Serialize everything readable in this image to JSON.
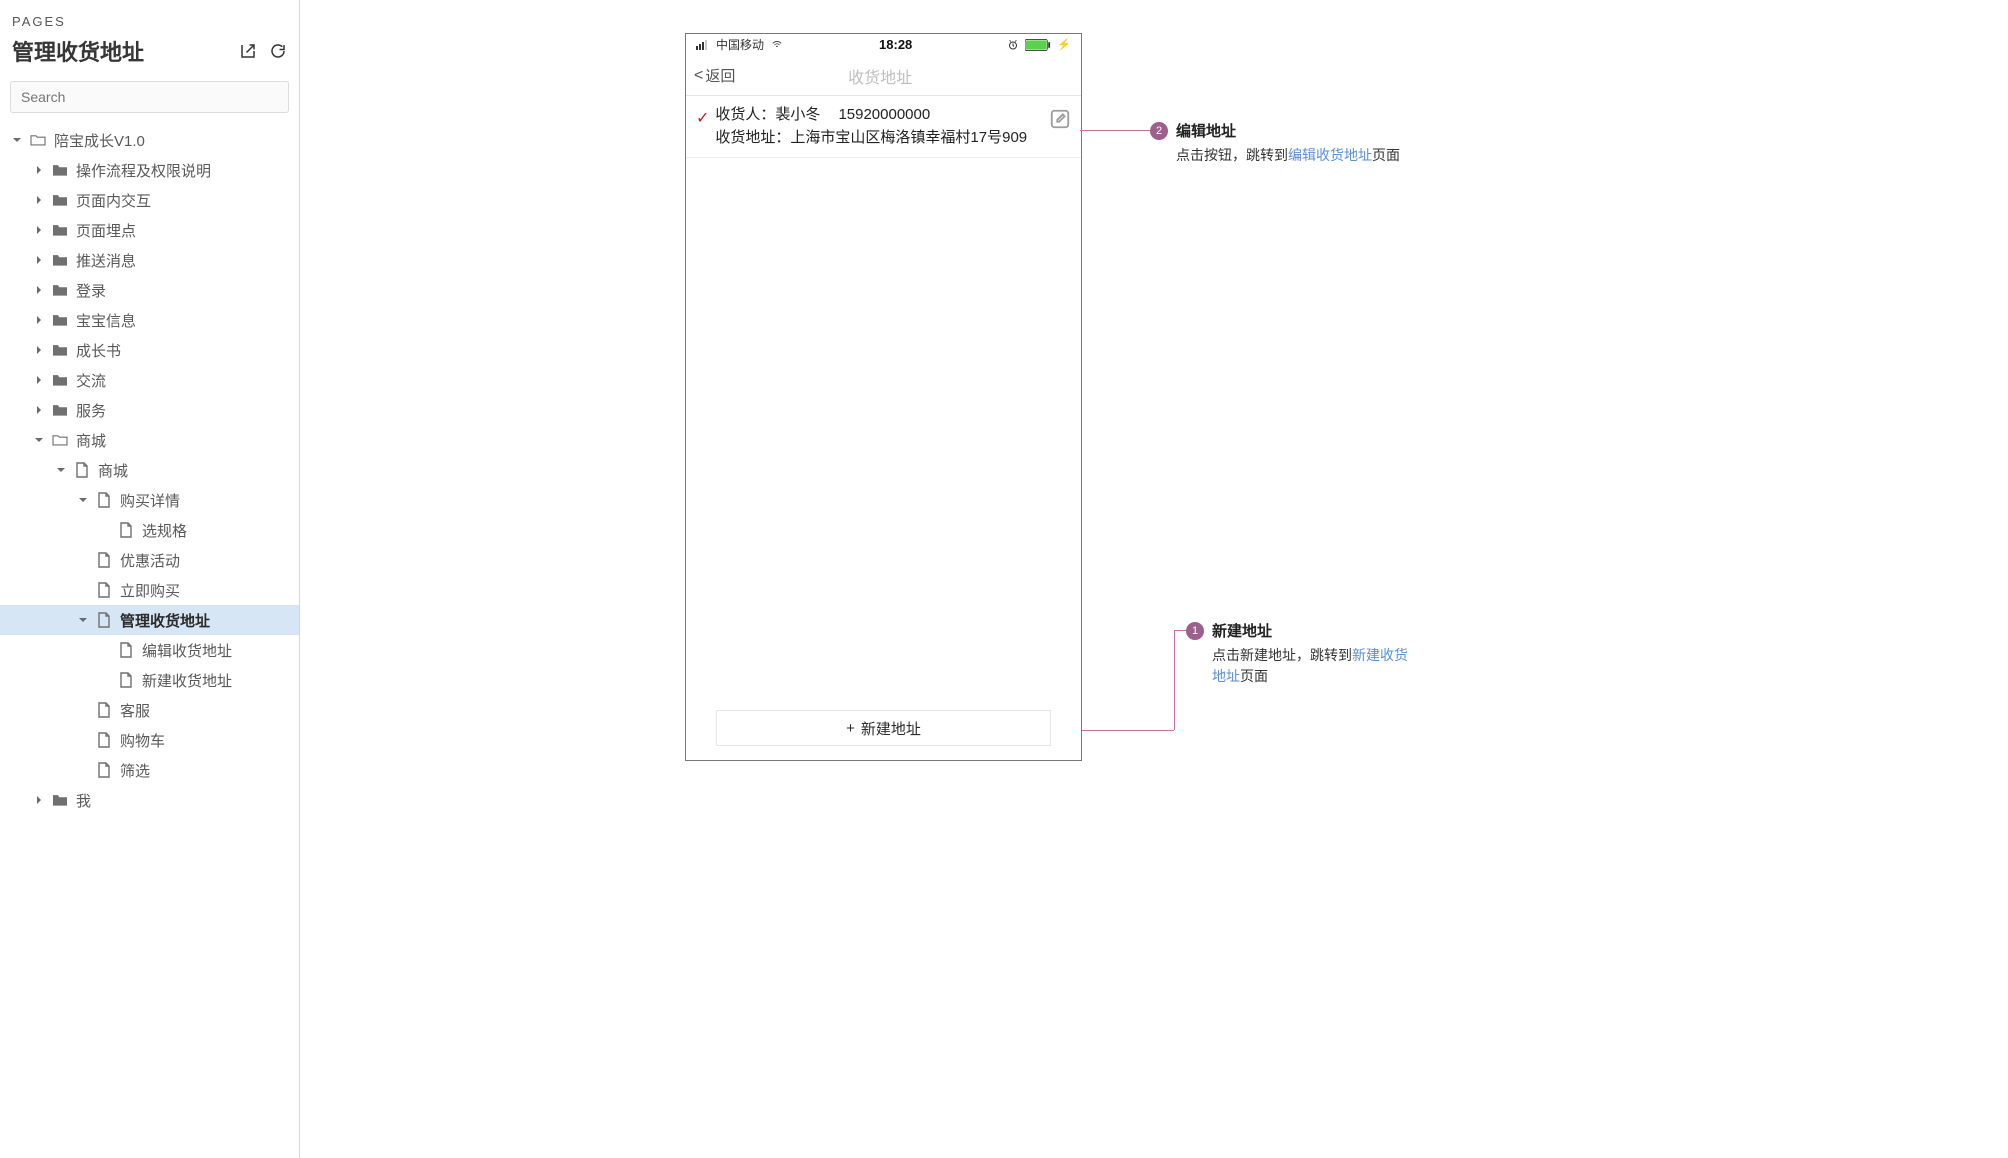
{
  "sidebar": {
    "pages_label": "PAGES",
    "page_title": "管理收货地址",
    "search_placeholder": "Search",
    "tree": [
      {
        "label": "陪宝成长V1.0",
        "icon": "folder-open",
        "indent": 0,
        "arrow": "down"
      },
      {
        "label": "操作流程及权限说明",
        "icon": "folder",
        "indent": 1,
        "arrow": "right"
      },
      {
        "label": "页面内交互",
        "icon": "folder",
        "indent": 1,
        "arrow": "right"
      },
      {
        "label": "页面埋点",
        "icon": "folder",
        "indent": 1,
        "arrow": "right"
      },
      {
        "label": "推送消息",
        "icon": "folder",
        "indent": 1,
        "arrow": "right"
      },
      {
        "label": "登录",
        "icon": "folder",
        "indent": 1,
        "arrow": "right"
      },
      {
        "label": "宝宝信息",
        "icon": "folder",
        "indent": 1,
        "arrow": "right"
      },
      {
        "label": "成长书",
        "icon": "folder",
        "indent": 1,
        "arrow": "right"
      },
      {
        "label": "交流",
        "icon": "folder",
        "indent": 1,
        "arrow": "right"
      },
      {
        "label": "服务",
        "icon": "folder",
        "indent": 1,
        "arrow": "right"
      },
      {
        "label": "商城",
        "icon": "folder-open",
        "indent": 1,
        "arrow": "down"
      },
      {
        "label": "商城",
        "icon": "page",
        "indent": 2,
        "arrow": "down"
      },
      {
        "label": "购买详情",
        "icon": "page",
        "indent": 3,
        "arrow": "down"
      },
      {
        "label": "选规格",
        "icon": "page",
        "indent": 4,
        "arrow": ""
      },
      {
        "label": "优惠活动",
        "icon": "page",
        "indent": 3,
        "arrow": ""
      },
      {
        "label": "立即购买",
        "icon": "page",
        "indent": 3,
        "arrow": ""
      },
      {
        "label": "管理收货地址",
        "icon": "page",
        "indent": 3,
        "arrow": "down",
        "selected": true
      },
      {
        "label": "编辑收货地址",
        "icon": "page",
        "indent": 4,
        "arrow": ""
      },
      {
        "label": "新建收货地址",
        "icon": "page",
        "indent": 4,
        "arrow": ""
      },
      {
        "label": "客服",
        "icon": "page",
        "indent": 3,
        "arrow": ""
      },
      {
        "label": "购物车",
        "icon": "page",
        "indent": 3,
        "arrow": ""
      },
      {
        "label": "筛选",
        "icon": "page",
        "indent": 3,
        "arrow": ""
      },
      {
        "label": "我",
        "icon": "folder",
        "indent": 1,
        "arrow": "right"
      }
    ]
  },
  "phone": {
    "carrier": "中国移动",
    "time": "18:28",
    "back_label": "返回",
    "nav_title": "收货地址",
    "address": {
      "recipient_label": "收货人：",
      "recipient_name": "裴小冬",
      "phone": "15920000000",
      "addr_label": "收货地址：",
      "addr_value": "上海市宝山区梅洛镇幸福村17号909"
    },
    "new_button": "新建地址"
  },
  "annos": {
    "a1": {
      "num": "1",
      "title": "新建地址",
      "desc_pre": "点击新建地址，跳转到",
      "desc_link": "新建收货地址",
      "desc_post": "页面"
    },
    "a2": {
      "num": "2",
      "title": "编辑地址",
      "desc_pre": "点击按钮，跳转到",
      "desc_link": "编辑收货地址",
      "desc_post": "页面"
    }
  }
}
